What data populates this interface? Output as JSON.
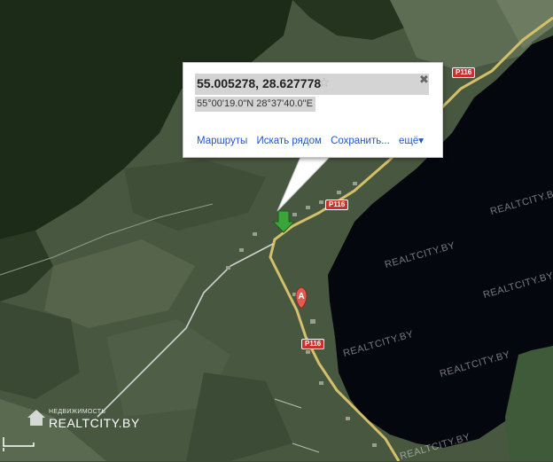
{
  "map": {
    "type": "satellite",
    "colors": {
      "lake": "#05070e",
      "road": "#d5c06a",
      "field": "#4e5e46",
      "forest": "#1b2a17"
    }
  },
  "popup": {
    "coordinates": "55.005278, 28.627778",
    "coordinates_dms": "55°00'19.0\"N 28°37'40.0\"E",
    "close_icon": "close-icon",
    "star_icon": "star-icon",
    "links": [
      "Маршруты",
      "Искать рядом",
      "Сохранить...",
      "ещё▾"
    ]
  },
  "road_labels": [
    "P116",
    "P116",
    "P116"
  ],
  "marker_a": {
    "label": "A"
  },
  "watermark": {
    "small": "НЕДВИЖИМОСТЬ",
    "big": "REALTCITY.BY"
  },
  "watermarks_repeat": [
    "REALTCITY.BY",
    "REALTCITY.BY",
    "REALTCITY.BY",
    "REALTCITY.BY",
    "REALTCITY.BY",
    "REALTCITY.BY"
  ]
}
